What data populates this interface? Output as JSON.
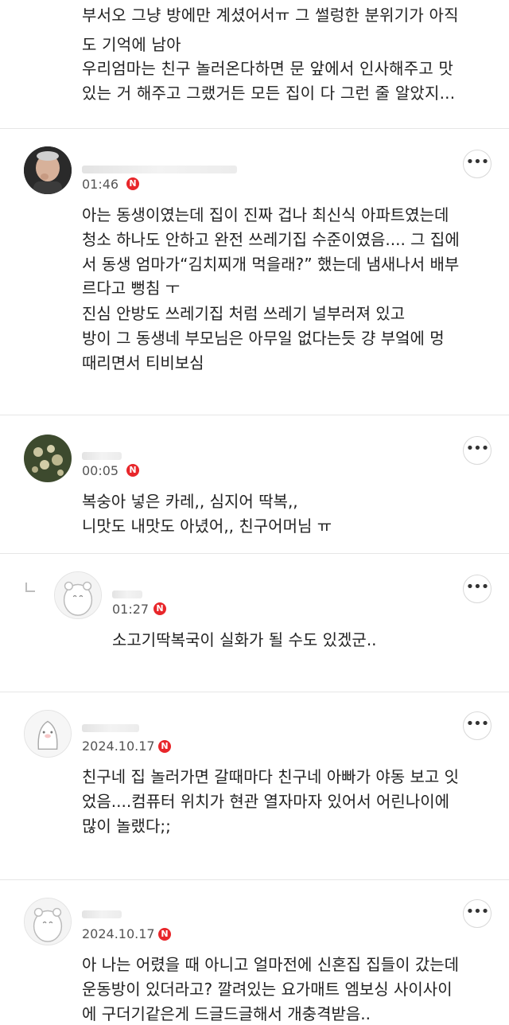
{
  "top_fragment": {
    "lines": [
      "부서오 그냥 방에만 계셨어서ㅠ 그 썰렁한 분위기가 아직",
      "도 기억에 남아",
      "우리엄마는 친구 놀러온다하면 문 앞에서 인사해주고 맛",
      "있는 거 해주고 그랬거든 모든 집이 다 그런 줄 알았지..."
    ]
  },
  "comments": [
    {
      "time": "01:46",
      "badge": "N",
      "lines": [
        "아는 동생이였는데 집이 진짜 겁나 최신식 아파트였는데",
        "청소 하나도 안하고 완전 쓰레기집 수준이였음.... 그 집에",
        "서 동생 엄마가“김치찌개 먹을래?” 했는데 냄새나서 배부",
        "르다고 뻥침 ㅜ",
        "진심 안방도 쓰레기집 처럼 쓰레기 널부러져 있고",
        "방이  그 동생네 부모님은 아무일 없다는듯 걍 부엌에 멍",
        "때리면서 티비보심"
      ]
    },
    {
      "time": "00:05",
      "badge": "N",
      "lines": [
        "복숭아 넣은 카레,, 심지어 딱복,,",
        "니맛도 내맛도 아녔어,, 친구어머님 ㅠ"
      ]
    },
    {
      "time": "01:27",
      "badge": "N",
      "is_reply": true,
      "lines": [
        "소고기딱복국이 실화가 될 수도 있겠군.."
      ]
    },
    {
      "time": "2024.10.17",
      "badge": "N",
      "lines": [
        "친구네 집 놀러가면 갈때마다 친구네 아빠가 야동 보고 잇",
        "었음....컴퓨터 위치가 현관 열자마자 있어서 어린나이에",
        "많이 놀랬다;;"
      ]
    },
    {
      "time": "2024.10.17",
      "badge": "N",
      "lines": [
        "아 나는 어렸을 때 아니고 얼마전에 신혼집 집들이 갔는데",
        "운동방이 있더라고? 깔려있는 요가매트 엠보싱 사이사이",
        "에 구더기같은게 드글드글해서 개충격받음.."
      ]
    }
  ],
  "more_label": "•••",
  "colors": {
    "badge": "#e8262a",
    "divider": "#e6e6e6",
    "text": "#222222",
    "time": "#555555"
  },
  "icons": [
    "more-options-icon",
    "new-badge-icon",
    "reply-arrow-icon"
  ]
}
